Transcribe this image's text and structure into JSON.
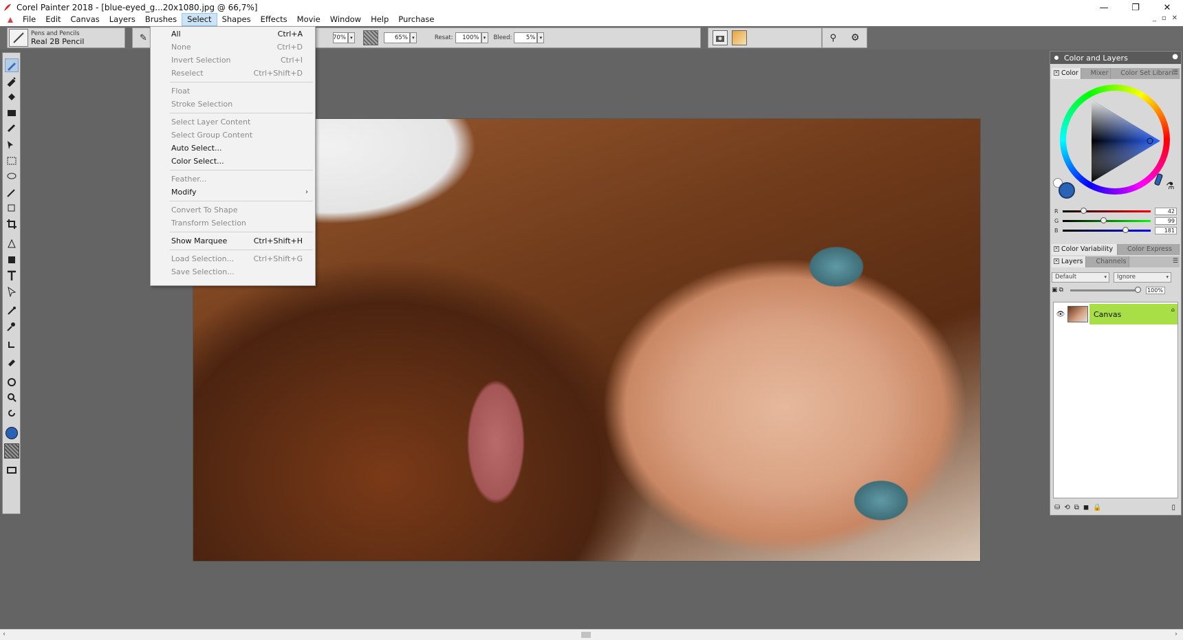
{
  "window": {
    "title": "Corel Painter 2018 - [blue-eyed_g...20x1080.jpg @ 66,7%]",
    "minimize": "—",
    "maximize": "❐",
    "close": "✕"
  },
  "menubar": {
    "items": [
      "File",
      "Edit",
      "Canvas",
      "Layers",
      "Brushes",
      "Select",
      "Shapes",
      "Effects",
      "Movie",
      "Window",
      "Help",
      "Purchase"
    ],
    "active": "Select",
    "mdi": [
      "_",
      "▫",
      "✕"
    ]
  },
  "propbar": {
    "brush_category": "Pens and Pencils",
    "brush_name": "Real 2B Pencil",
    "opacity_value": "70%",
    "grain_value": "65%",
    "resat_label": "Resat:",
    "resat_value": "100%",
    "bleed_label": "Bleed:",
    "bleed_value": "5%"
  },
  "select_menu": {
    "items": [
      {
        "label": "All",
        "shortcut": "Ctrl+A",
        "enabled": true
      },
      {
        "label": "None",
        "shortcut": "Ctrl+D",
        "enabled": false
      },
      {
        "label": "Invert Selection",
        "shortcut": "Ctrl+I",
        "enabled": false
      },
      {
        "label": "Reselect",
        "shortcut": "Ctrl+Shift+D",
        "enabled": false
      },
      {
        "label": "Float",
        "shortcut": "",
        "enabled": false
      },
      {
        "label": "Stroke Selection",
        "shortcut": "",
        "enabled": false
      },
      {
        "label": "Select Layer Content",
        "shortcut": "",
        "enabled": false
      },
      {
        "label": "Select Group Content",
        "shortcut": "",
        "enabled": false
      },
      {
        "label": "Auto Select...",
        "shortcut": "",
        "enabled": true
      },
      {
        "label": "Color Select...",
        "shortcut": "",
        "enabled": true
      },
      {
        "label": "Feather...",
        "shortcut": "",
        "enabled": false
      },
      {
        "label": "Modify",
        "shortcut": "",
        "enabled": true,
        "submenu": true
      },
      {
        "label": "Convert To Shape",
        "shortcut": "",
        "enabled": false
      },
      {
        "label": "Transform Selection",
        "shortcut": "",
        "enabled": false
      },
      {
        "label": "Show Marquee",
        "shortcut": "Ctrl+Shift+H",
        "enabled": true
      },
      {
        "label": "Load Selection...",
        "shortcut": "Ctrl+Shift+G",
        "enabled": false
      },
      {
        "label": "Save Selection...",
        "shortcut": "",
        "enabled": false
      }
    ]
  },
  "panel": {
    "title": "Color and Layers",
    "color_tabs": [
      "Color",
      "Mixer",
      "Color Set Librari"
    ],
    "rgb": {
      "r_label": "R",
      "g_label": "G",
      "b_label": "B",
      "r": "42",
      "g": "99",
      "b": "181"
    },
    "variability_tabs": [
      "Color Variability",
      "Color Express"
    ],
    "layers_tabs": [
      "Layers",
      "Channels"
    ],
    "composite_method": "Default",
    "composite_depth": "Ignore",
    "layer_opacity": "100%",
    "layers": [
      {
        "name": "Canvas"
      }
    ]
  },
  "colors": {
    "main_color": "#2a63b5",
    "selected_layer": "#a8df46",
    "menu_highlight": "#cde4f7"
  }
}
